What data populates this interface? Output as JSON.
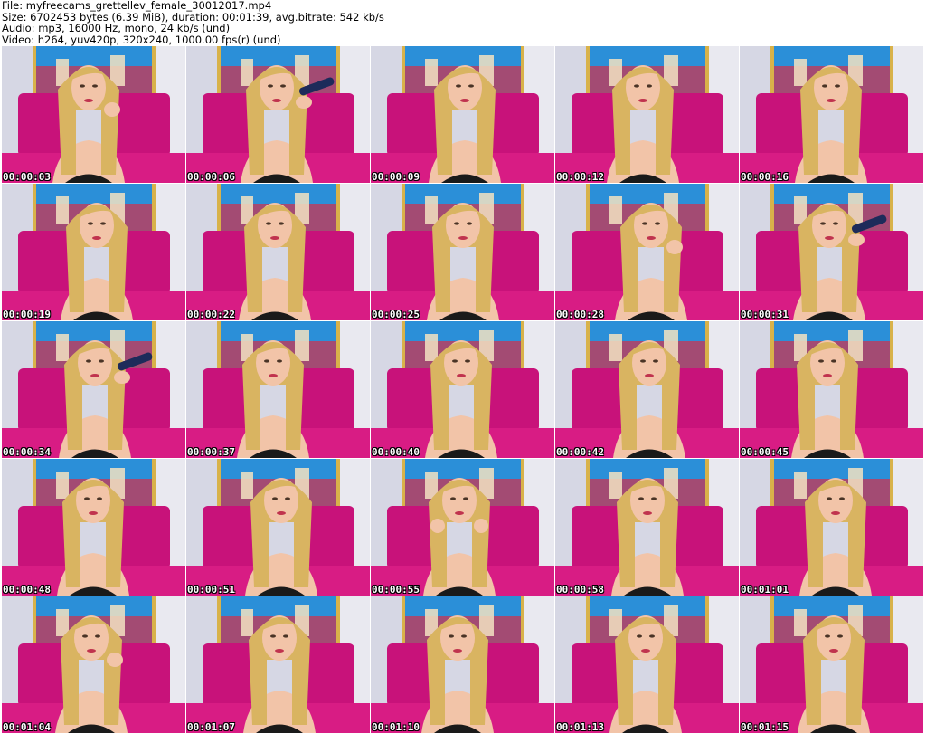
{
  "header": {
    "file_line": "File: myfreecams_grettellev_female_30012017.mp4",
    "size_line": "Size: 6702453 bytes (6.39 MiB), duration: 00:01:39, avg.bitrate: 542 kb/s",
    "audio_line": "Audio: mp3, 16000 Hz, mono, 24 kb/s (und)",
    "video_line": "Video: h264, yuv420p, 320x240, 1000.00 fps(r) (und)"
  },
  "colors": {
    "wall": "#d6d7e4",
    "painting_blue": "#2b8fd8",
    "painting_red": "#c23a5a",
    "frame_gold": "#d8b24a",
    "cushion": "#c8127a",
    "hair": "#d9b461",
    "skin": "#f2c4a8",
    "top": "#1a1a1a"
  },
  "thumbnails": [
    {
      "time": "00:00:03",
      "pose": "hand-hair"
    },
    {
      "time": "00:00:06",
      "pose": "iron"
    },
    {
      "time": "00:00:09",
      "pose": "front"
    },
    {
      "time": "00:00:12",
      "pose": "front"
    },
    {
      "time": "00:00:16",
      "pose": "front"
    },
    {
      "time": "00:00:19",
      "pose": "front"
    },
    {
      "time": "00:00:22",
      "pose": "front"
    },
    {
      "time": "00:00:25",
      "pose": "front"
    },
    {
      "time": "00:00:28",
      "pose": "hand-hair"
    },
    {
      "time": "00:00:31",
      "pose": "iron"
    },
    {
      "time": "00:00:34",
      "pose": "iron"
    },
    {
      "time": "00:00:37",
      "pose": "front"
    },
    {
      "time": "00:00:40",
      "pose": "front"
    },
    {
      "time": "00:00:42",
      "pose": "front"
    },
    {
      "time": "00:00:45",
      "pose": "front"
    },
    {
      "time": "00:00:48",
      "pose": "front"
    },
    {
      "time": "00:00:51",
      "pose": "front"
    },
    {
      "time": "00:00:55",
      "pose": "hands-neck"
    },
    {
      "time": "00:00:58",
      "pose": "front"
    },
    {
      "time": "00:01:01",
      "pose": "front"
    },
    {
      "time": "00:01:04",
      "pose": "hand-hair"
    },
    {
      "time": "00:01:07",
      "pose": "front"
    },
    {
      "time": "00:01:10",
      "pose": "front"
    },
    {
      "time": "00:01:13",
      "pose": "front"
    },
    {
      "time": "00:01:15",
      "pose": "front"
    }
  ]
}
